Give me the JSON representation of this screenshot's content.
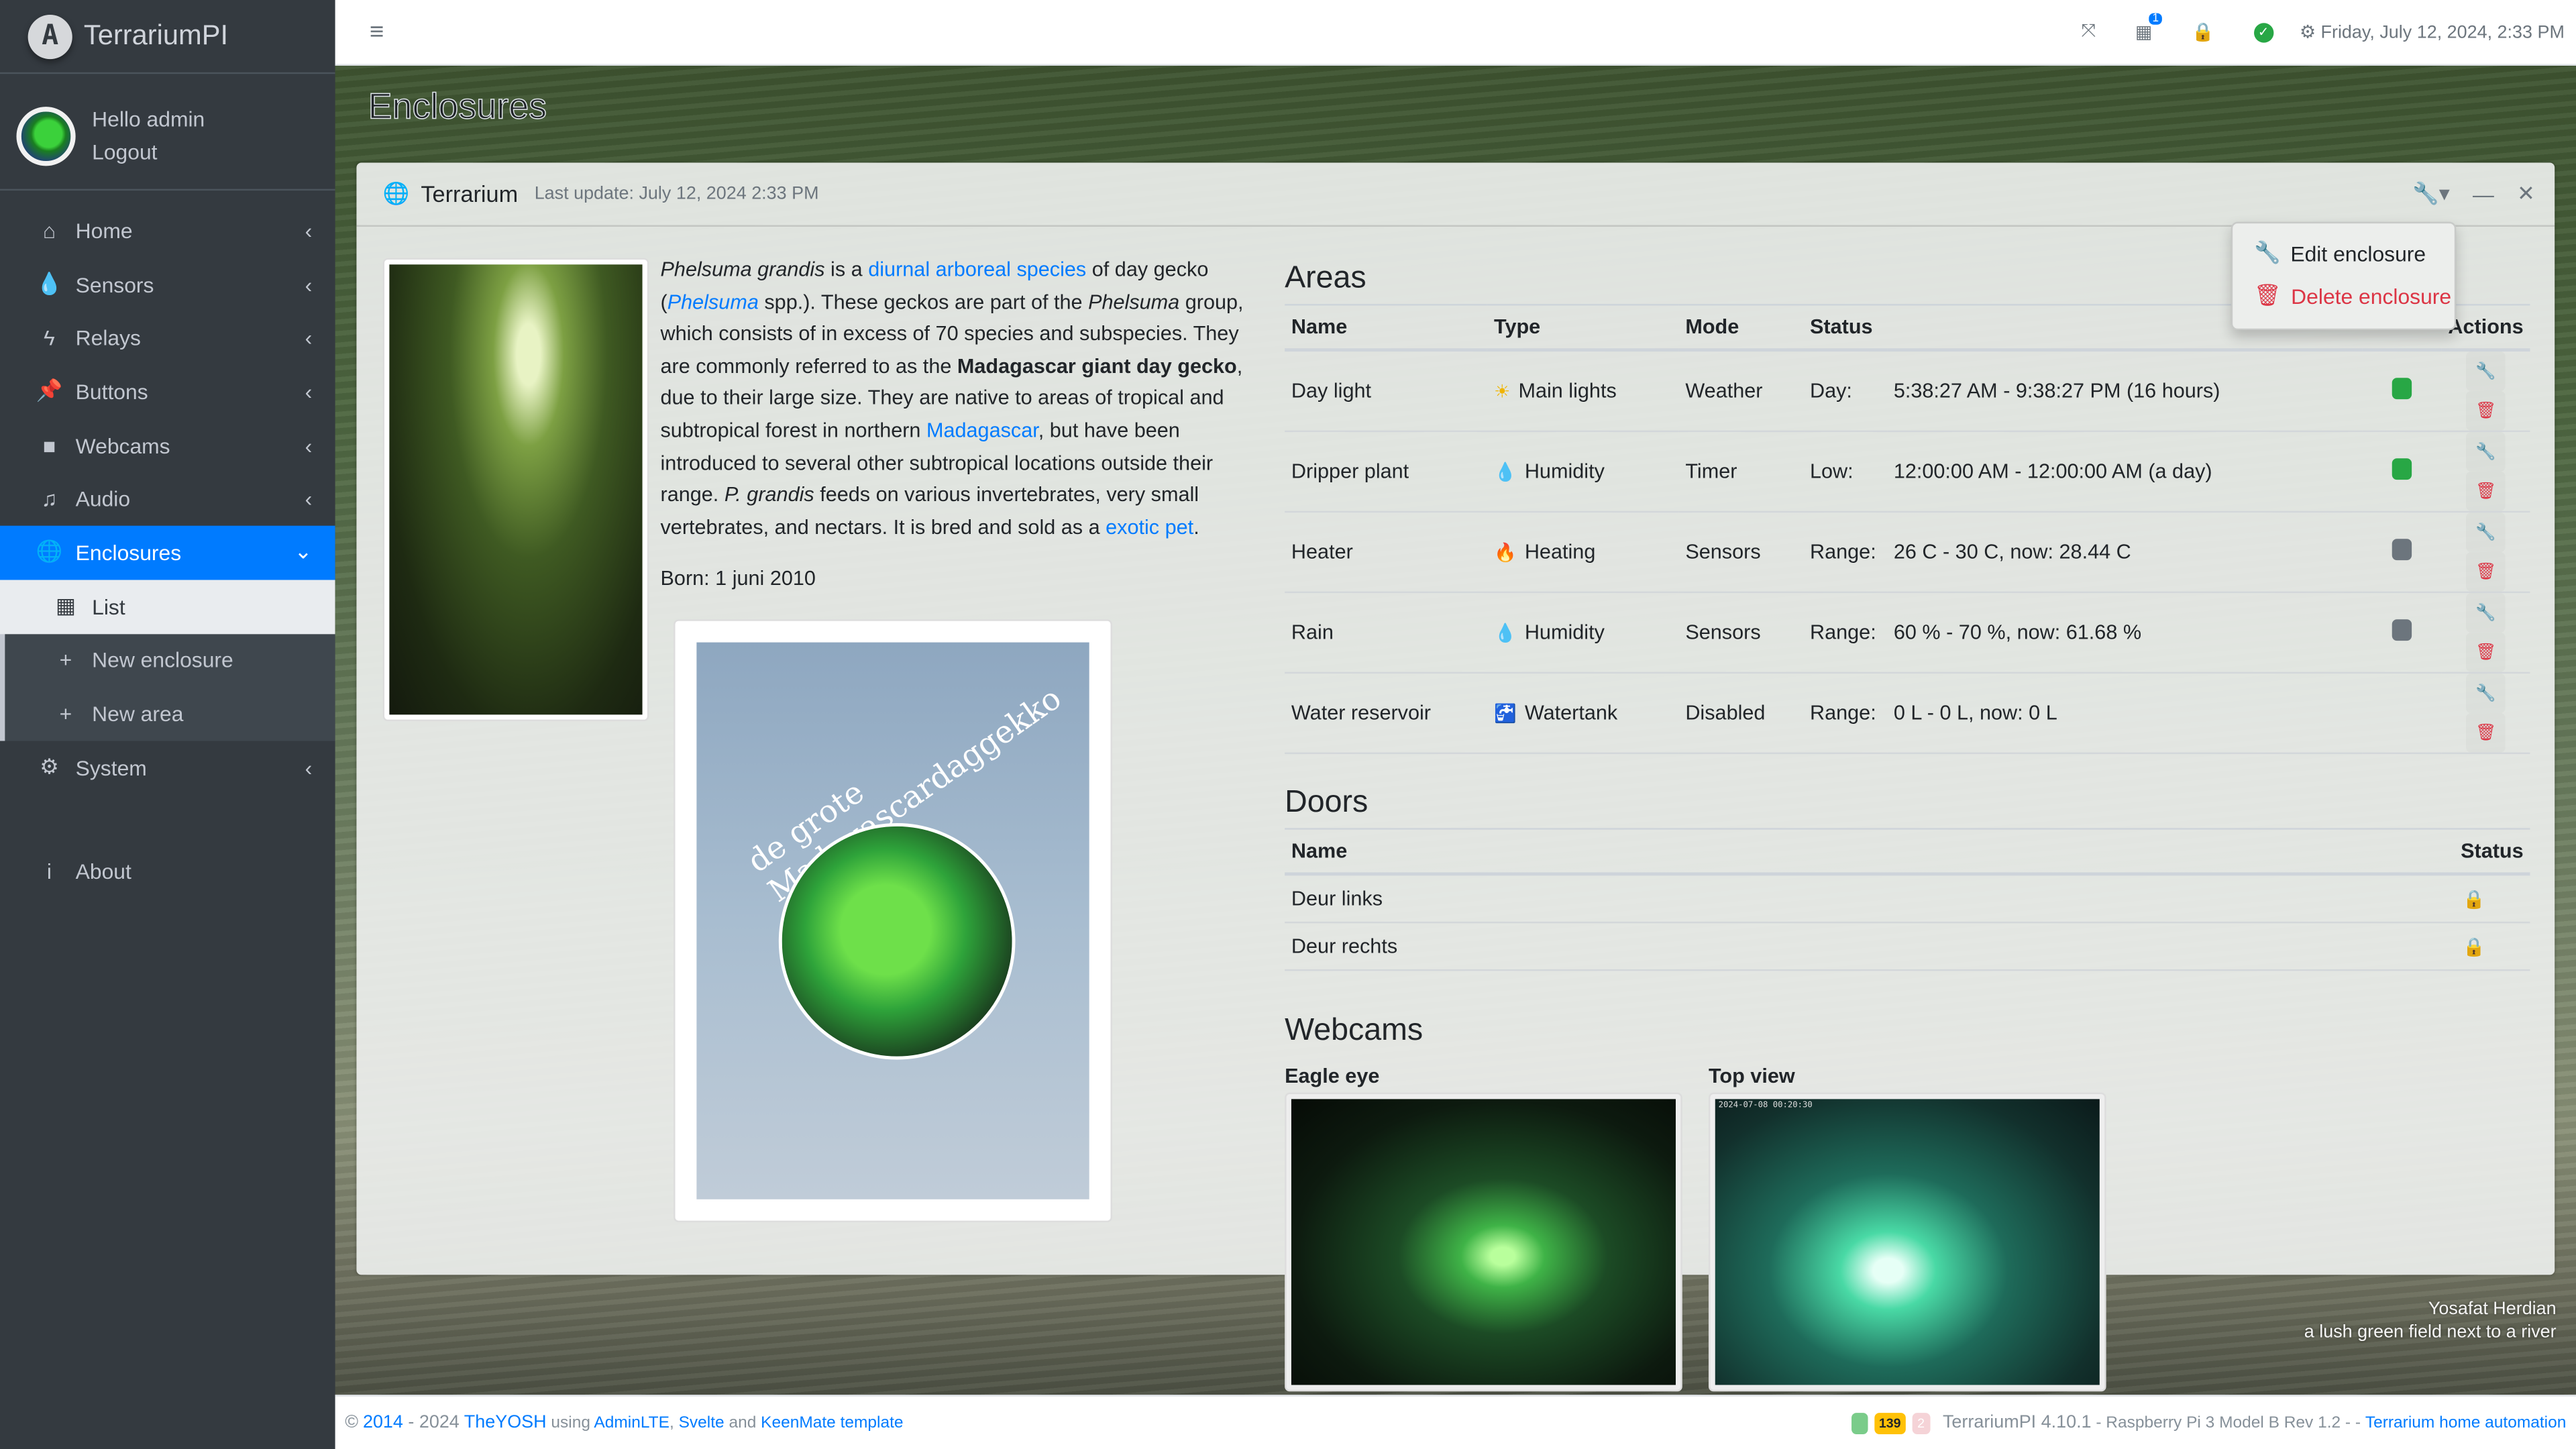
{
  "brand": {
    "logo_letter": "A",
    "name": "TerrariumPI"
  },
  "user": {
    "greeting": "Hello admin",
    "logout": "Logout"
  },
  "sidebar": {
    "items": [
      {
        "label": "Home",
        "icon": "⌂"
      },
      {
        "label": "Sensors",
        "icon": "💧"
      },
      {
        "label": "Relays",
        "icon": "ϟ"
      },
      {
        "label": "Buttons",
        "icon": "📌"
      },
      {
        "label": "Webcams",
        "icon": "■"
      },
      {
        "label": "Audio",
        "icon": "♫"
      },
      {
        "label": "Enclosures",
        "icon": "🌐"
      }
    ],
    "sub_items": [
      {
        "label": "List",
        "icon": "▦"
      },
      {
        "label": "New enclosure",
        "icon": "+"
      },
      {
        "label": "New area",
        "icon": "+"
      }
    ],
    "system": {
      "label": "System",
      "icon": "⚙"
    },
    "about": {
      "label": "About",
      "icon": "i"
    },
    "chevron_left": "‹",
    "chevron_down": "⌄"
  },
  "topbar": {
    "menu_icon": "≡",
    "fullscreen_icon": "⤧",
    "calendar_icon": "▦",
    "calendar_badge": "1",
    "lock_icon": "🔒",
    "status_icon": "✓",
    "gear_icon": "⚙",
    "datetime": "Friday, July 12, 2024, 2:33 PM"
  },
  "page": {
    "title": "Enclosures"
  },
  "card": {
    "icon": "🌐",
    "title": "Terrarium",
    "last_update": "Last update: July 12, 2024 2:33 PM",
    "tools": {
      "wrench": "🔧▾",
      "minimize": "—",
      "close": "✕"
    },
    "dropdown": {
      "edit": "Edit enclosure",
      "delete": "Delete enclosure"
    }
  },
  "description": {
    "p1_italic": "Phelsuma grandis",
    "p1_a": " is a ",
    "link1": "diurnal arboreal species",
    "p1_b": " of day gecko (",
    "link2": "Phelsuma",
    "p1_c": " spp.). These geckos are part of the ",
    "p1_italic2": "Phelsuma",
    "p1_d": " group, which consists of in excess of 70 species and subspecies. They are commonly referred to as the ",
    "p1_bold": "Madagascar giant day gecko",
    "p1_e": ", due to their large size. They are native to areas of tropical and subtropical forest in northern ",
    "link3": "Madagascar",
    "p1_f": ", but have been introduced to several other subtropical locations outside their range. ",
    "p1_italic3": "P. grandis",
    "p1_g": " feeds on various invertebrates, very small vertebrates, and nectars. It is bred and sold as a ",
    "link4": "exotic pet",
    "p1_h": ".",
    "born": "Born: 1 juni 2010"
  },
  "poster": {
    "title_line": "de grote Madagascardaggekko"
  },
  "areas": {
    "heading": "Areas",
    "columns": [
      "Name",
      "Type",
      "Mode",
      "Status",
      "",
      "",
      "Actions"
    ],
    "rows": [
      {
        "name": "Day light",
        "type": "Main lights",
        "type_icon": "☀",
        "type_color": "#f0b400",
        "mode": "Weather",
        "status_label": "Day:",
        "status_value": "5:38:27 AM - 9:38:27 PM (16 hours)",
        "indicator": "#28a745"
      },
      {
        "name": "Dripper plant",
        "type": "Humidity",
        "type_icon": "💧",
        "type_color": "#17a2b8",
        "mode": "Timer",
        "status_label": "Low:",
        "status_value": "12:00:00 AM - 12:00:00 AM (a day)",
        "indicator": "#28a745"
      },
      {
        "name": "Heater",
        "type": "Heating",
        "type_icon": "🔥",
        "type_color": "#dc3545",
        "mode": "Sensors",
        "status_label": "Range:",
        "status_value": "26 C - 30 C, now: 28.44 C",
        "indicator": "#6c757d"
      },
      {
        "name": "Rain",
        "type": "Humidity",
        "type_icon": "💧",
        "type_color": "#17a2b8",
        "mode": "Sensors",
        "status_label": "Range:",
        "status_value": "60 % - 70 %, now: 61.68 %",
        "indicator": "#6c757d"
      },
      {
        "name": "Water reservoir",
        "type": "Watertank",
        "type_icon": "🚰",
        "type_color": "#007bff",
        "mode": "Disabled",
        "status_label": "Range:",
        "status_value": "0 L - 0 L, now: 0 L",
        "indicator": null
      }
    ],
    "edit_icon": "🔧",
    "delete_icon": "🗑"
  },
  "doors": {
    "heading": "Doors",
    "columns": [
      "Name",
      "Status"
    ],
    "rows": [
      {
        "name": "Deur links",
        "status_icon": "🔒",
        "status_color": "#28a745"
      },
      {
        "name": "Deur rechts",
        "status_icon": "🔒",
        "status_color": "#28a745"
      }
    ]
  },
  "webcams": {
    "heading": "Webcams",
    "items": [
      {
        "name": "Eagle eye",
        "timestamp": ""
      },
      {
        "name": "Top view",
        "timestamp": "2024-07-08 00:20:30"
      }
    ]
  },
  "background_credit": {
    "author": "Yosafat Herdian",
    "caption": "a lush green field next to a river"
  },
  "footer": {
    "copyright": "©",
    "year_start": "2014",
    "dash_year": " - 2024 ",
    "author": "TheYOSH",
    "using": " using ",
    "adminlte": "AdminLTE",
    "comma": ", ",
    "svelte": "Svelte",
    "and": " and ",
    "keenmate": "KeenMate template",
    "badge_yellow": "139",
    "badge_pink": "2",
    "version": "TerrariumPI 4.10.1",
    "device": " - Raspberry Pi 3 Model B Rev 1.2 - - ",
    "tagline": "Terrarium home automation"
  },
  "colors": {
    "accent": "#007bff",
    "sidebar_bg": "#343a40",
    "danger": "#dc3545",
    "success": "#28a745"
  }
}
